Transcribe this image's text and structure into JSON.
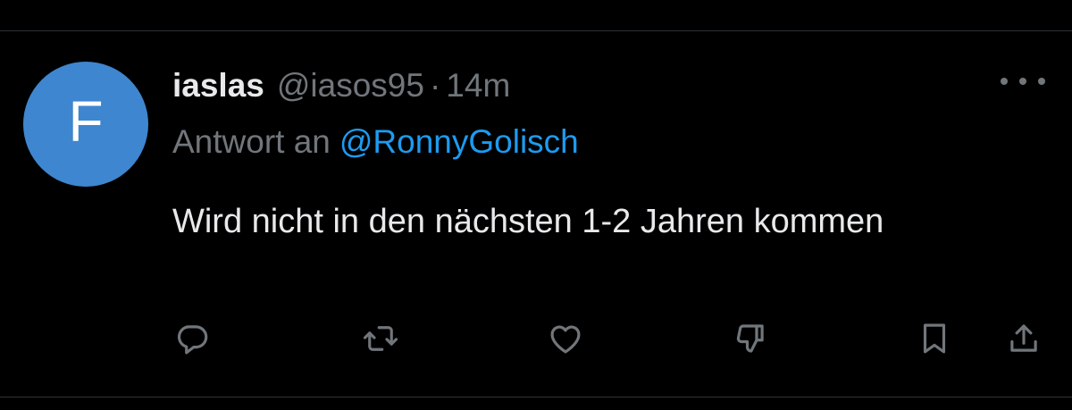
{
  "tweet": {
    "avatar_letter": "F",
    "display_name": "iaslas",
    "handle": "@iasos95",
    "separator": "·",
    "time": "14m",
    "reply_prefix": "Antwort an",
    "reply_mention": "@RonnyGolisch",
    "text": "Wird nicht in den nächsten 1-2 Jahren kommen"
  },
  "actions": [
    {
      "icon": "reply-icon"
    },
    {
      "icon": "retweet-icon"
    },
    {
      "icon": "like-heart-icon"
    },
    {
      "icon": "dislike-icon"
    },
    {
      "icon": "bookmark-icon"
    },
    {
      "icon": "share-icon"
    }
  ],
  "colors": {
    "background": "#000000",
    "avatar": "#3e86cf",
    "mention": "#1d9bf0",
    "secondary_text": "#71767b",
    "primary_text": "#e7e9ea",
    "divider": "#2f3336"
  }
}
